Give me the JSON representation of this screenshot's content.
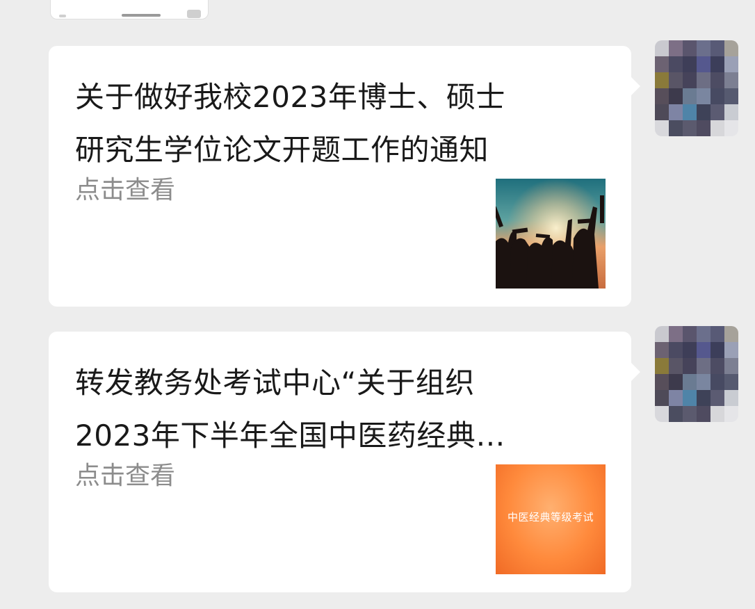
{
  "messages": [
    {
      "title_lines": [
        "关于做好我校2023年博士、硕士",
        "研究生学位论文开题工作的通知"
      ],
      "subtitle": "点击查看",
      "thumbnail": {
        "type": "photo",
        "icon": "graduation-silhouette-photo"
      }
    },
    {
      "title_lines": [
        "转发教务处考试中心“关于组织",
        "2023年下半年全国中医药经典…"
      ],
      "subtitle": "点击查看",
      "thumbnail": {
        "type": "text",
        "text": "中医经典等级考试"
      }
    }
  ],
  "colors": {
    "background": "#ededed",
    "card": "#ffffff",
    "title": "#191919",
    "subtitle": "#8c8c8c",
    "thumb_orange": "#ff8a3c"
  }
}
